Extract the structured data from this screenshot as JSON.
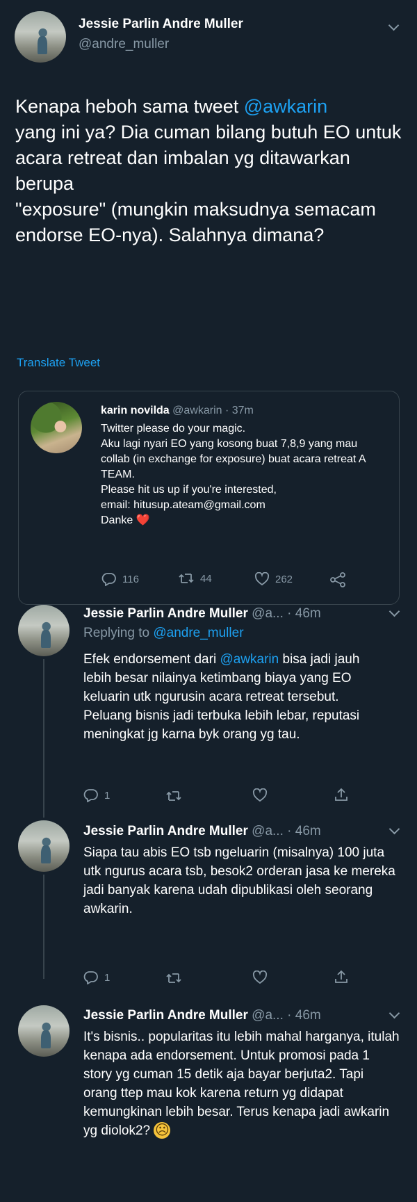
{
  "main_tweet": {
    "author_name": "Jessie Parlin Andre Muller",
    "author_handle": "@andre_muller",
    "text_part1": "Kenapa heboh sama tweet ",
    "mention": "@awkarin",
    "text_part2": " \nyang ini ya? Dia cuman bilang butuh EO untuk acara retreat dan imbalan yg ditawarkan berupa\n\"exposure\" (mungkin maksudnya semacam endorse EO-nya). Salahnya dimana?",
    "translate_label": "Translate Tweet"
  },
  "quoted_tweet": {
    "author_name": "karin novilda",
    "author_handle": "@awkarin",
    "time": "· 37m",
    "text": "Twitter please do your magic.\nAku lagi nyari EO yang kosong buat 7,8,9 yang mau collab (in exchange for exposure) buat acara retreat A TEAM.\nPlease hit us up if you're interested,\nemail: hitusup.ateam@gmail.com\nDanke",
    "heart_emoji": "❤️",
    "replies": "116",
    "retweets": "44",
    "likes": "262"
  },
  "replies": [
    {
      "author_name": "Jessie Parlin Andre Muller",
      "handle_trunc": "@a...",
      "time": "· 46m",
      "replying_label": "Replying to ",
      "replying_to": "@andre_muller",
      "text_part1": "Efek endorsement dari ",
      "mention": "@awkarin",
      "text_part2": " bisa jadi jauh lebih besar nilainya ketimbang biaya yang EO keluarin utk ngurusin acara retreat tersebut. Peluang bisnis jadi terbuka lebih lebar, reputasi meningkat jg karna byk orang yg tau.",
      "reply_count": "1"
    },
    {
      "author_name": "Jessie Parlin Andre Muller",
      "handle_trunc": "@a...",
      "time": "· 46m",
      "text": "Siapa tau abis EO tsb ngeluarin (misalnya) 100 juta utk ngurus acara tsb, besok2 orderan jasa ke mereka jadi banyak karena udah dipublikasi oleh seorang awkarin.",
      "reply_count": "1"
    },
    {
      "author_name": "Jessie Parlin Andre Muller",
      "handle_trunc": "@a...",
      "time": "· 46m",
      "text": "It's bisnis.. popularitas itu lebih mahal harganya, itulah kenapa ada endorsement. Untuk promosi pada 1 story yg cuman 15 detik aja bayar berjuta2. Tapi orang ttep mau kok karena return yg didapat kemungkinan lebih besar. Terus kenapa jadi awkarin yg diolok2?",
      "emoji": "☹"
    }
  ],
  "colors": {
    "background": "#15202b",
    "accent": "#1da1f2",
    "secondary_text": "#8899a6",
    "border": "#38444d"
  }
}
